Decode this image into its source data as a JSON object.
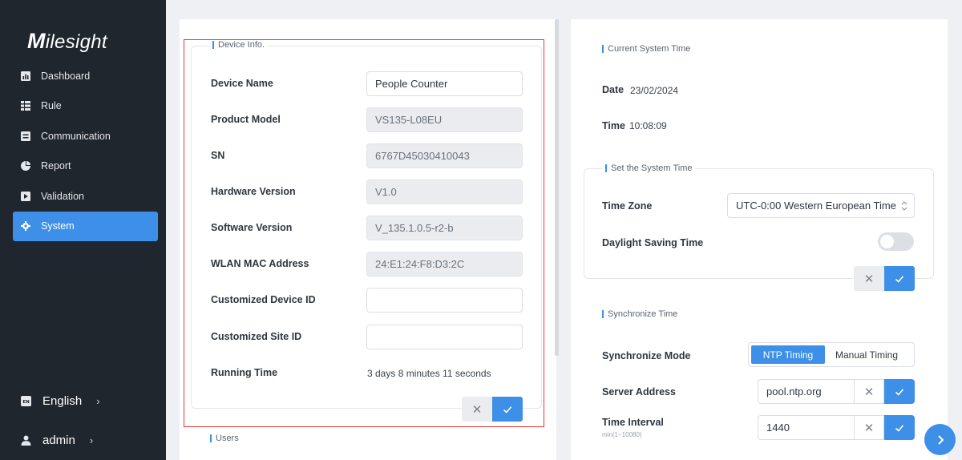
{
  "brand": {
    "logo": "Milesight"
  },
  "sidebar": {
    "items": [
      {
        "label": "Dashboard",
        "icon": "dashboard-icon"
      },
      {
        "label": "Rule",
        "icon": "rule-icon"
      },
      {
        "label": "Communication",
        "icon": "communication-icon"
      },
      {
        "label": "Report",
        "icon": "report-icon"
      },
      {
        "label": "Validation",
        "icon": "validation-icon"
      },
      {
        "label": "System",
        "icon": "gear-icon",
        "active": true
      }
    ],
    "language": {
      "label": "English",
      "icon": "language-icon"
    },
    "user": {
      "label": "admin",
      "icon": "user-icon"
    }
  },
  "device_info": {
    "title": "Device Info.",
    "rows": [
      {
        "label": "Device Name",
        "value": "People Counter",
        "editable": true
      },
      {
        "label": "Product Model",
        "value": "VS135-L08EU",
        "editable": false
      },
      {
        "label": "SN",
        "value": "6767D45030410043",
        "editable": false
      },
      {
        "label": "Hardware Version",
        "value": "V1.0",
        "editable": false
      },
      {
        "label": "Software Version",
        "value": "V_135.1.0.5-r2-b",
        "editable": false
      },
      {
        "label": "WLAN MAC Address",
        "value": "24:E1:24:F8:D3:2C",
        "editable": false
      },
      {
        "label": "Customized Device ID",
        "value": "",
        "editable": true
      },
      {
        "label": "Customized Site ID",
        "value": "",
        "editable": true
      },
      {
        "label": "Running Time",
        "value": "3 days 8 minutes 11 seconds",
        "editable": false,
        "plain": true
      }
    ],
    "cancel": "✕"
  },
  "users": {
    "title": "Users"
  },
  "current_time": {
    "title": "Current System Time",
    "date_label": "Date",
    "date_value": "23/02/2024",
    "time_label": "Time",
    "time_value": "10:08:09"
  },
  "set_time": {
    "title": "Set the System Time",
    "timezone_label": "Time Zone",
    "timezone_value": "UTC-0:00 Western European Time",
    "dst_label": "Daylight Saving Time",
    "dst_on": false
  },
  "sync": {
    "title": "Synchronize Time",
    "mode_label": "Synchronize Mode",
    "modes": [
      "NTP Timing",
      "Manual Timing"
    ],
    "active_mode": "NTP Timing",
    "server_label": "Server Address",
    "server_value": "pool.ntp.org",
    "interval_label": "Time Interval",
    "interval_hint": "min(1~10080)",
    "interval_value": "1440"
  },
  "colors": {
    "accent": "#3d8fe7",
    "sidebar": "#20262d",
    "highlight": "#e53935"
  }
}
